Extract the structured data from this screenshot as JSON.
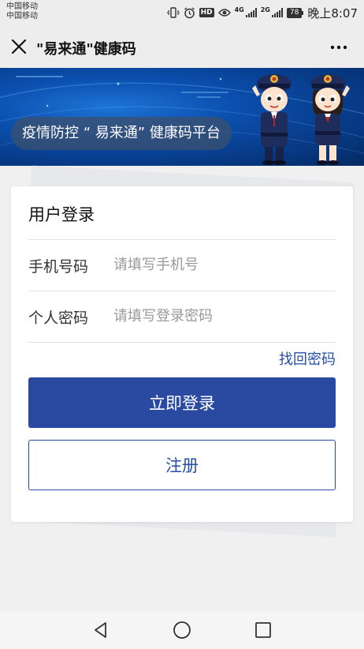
{
  "status_bar": {
    "carrier_1": "中国移动",
    "carrier_2": "中国移动",
    "network_1": "4G",
    "network_2": "2G",
    "battery": "78",
    "time": "晚上8:07",
    "icons": [
      "vibrate-icon",
      "alarm-icon",
      "hd-icon",
      "eye-icon",
      "signal-icon",
      "battery-icon"
    ]
  },
  "navbar": {
    "title": "\"易来通\"健康码",
    "close_icon": "close-icon",
    "more_icon": "more-icon"
  },
  "banner": {
    "text": "疫情防控 “ 易来通” 健康码平台"
  },
  "login": {
    "title": "用户登录",
    "phone_label": "手机号码",
    "phone_placeholder": "请填写手机号",
    "phone_value": "",
    "password_label": "个人密码",
    "password_placeholder": "请填写登录密码",
    "password_value": "",
    "forgot_label": "找回密码",
    "login_button": "立即登录",
    "register_button": "注册"
  },
  "colors": {
    "primary": "#2a4aa1",
    "link": "#244fa3",
    "banner_dark": "#062a63",
    "banner_light": "#1d74d6"
  },
  "bottom_nav": {
    "icons": [
      "back-icon",
      "home-icon",
      "recents-icon"
    ]
  }
}
